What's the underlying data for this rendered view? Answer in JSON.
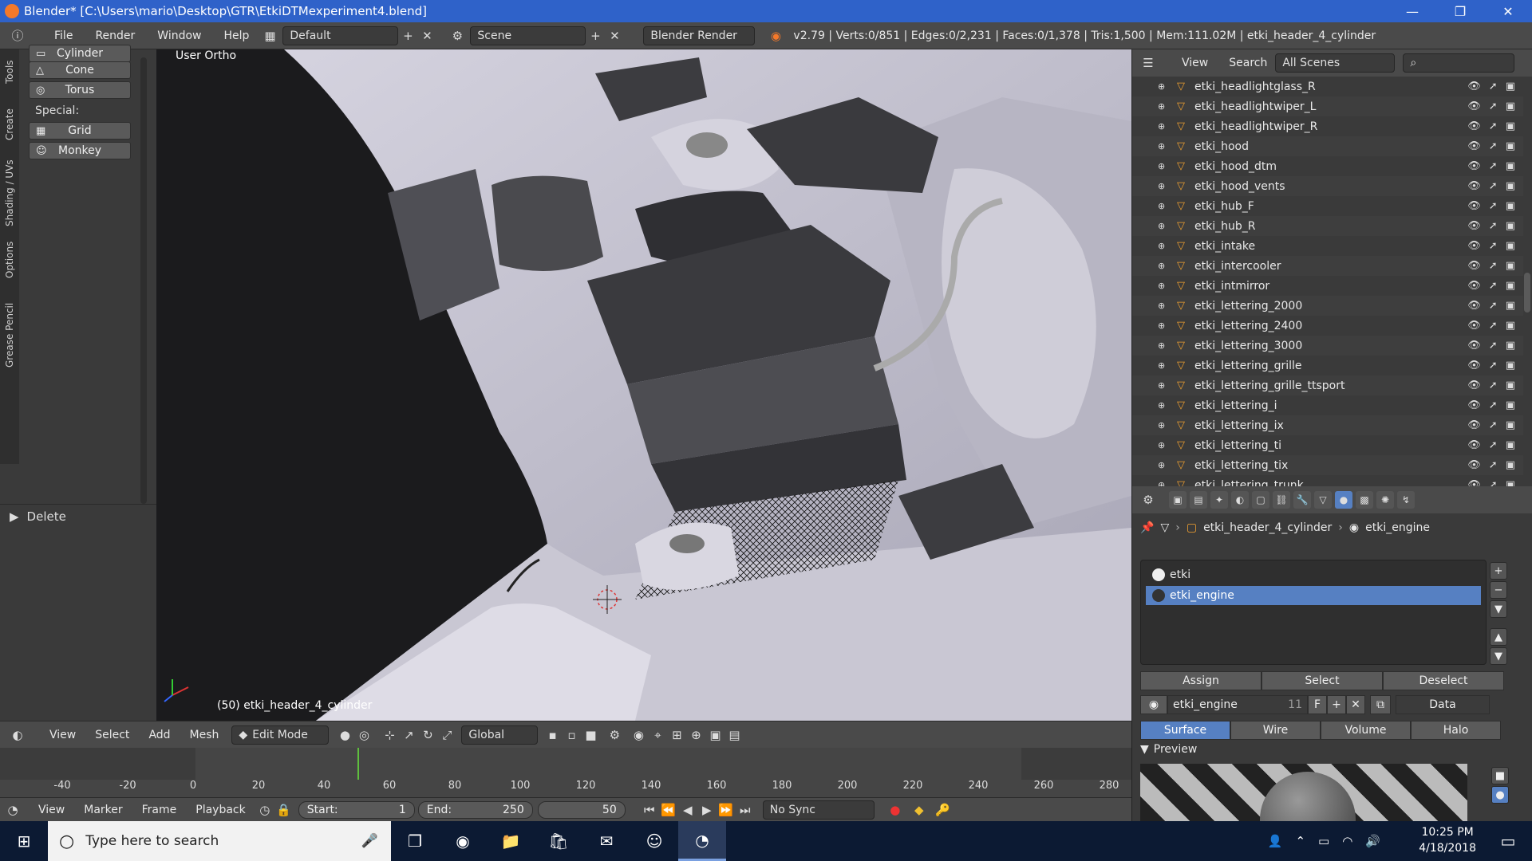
{
  "window": {
    "title": "Blender* [C:\\Users\\mario\\Desktop\\GTR\\EtkiDTMexperiment4.blend]",
    "min": "—",
    "max": "❐",
    "close": "✕"
  },
  "info": {
    "menus": [
      "File",
      "Render",
      "Window",
      "Help"
    ],
    "layout": "Default",
    "scene": "Scene",
    "engine": "Blender Render",
    "stats": "v2.79 | Verts:0/851 | Edges:0/2,231 | Faces:0/1,378 | Tris:1,500 | Mem:111.02M | etki_header_4_cylinder"
  },
  "toolshelf": {
    "tabs": [
      "Tools",
      "Create",
      "Shading / UVs",
      "Options",
      "Grease Pencil"
    ],
    "buttons": [
      "Cylinder",
      "Cone",
      "Torus"
    ],
    "special_label": "Special:",
    "special": [
      "Grid",
      "Monkey"
    ],
    "redo_label": "Delete"
  },
  "viewport": {
    "view_label": "User Ortho",
    "object_label": "(50) etki_header_4_cylinder"
  },
  "v3d_header": {
    "menus": [
      "View",
      "Select",
      "Add",
      "Mesh"
    ],
    "mode": "Edit Mode",
    "orientation": "Global"
  },
  "timeline": {
    "ticks": [
      "-40",
      "-20",
      "0",
      "20",
      "40",
      "60",
      "80",
      "100",
      "120",
      "140",
      "160",
      "180",
      "200",
      "220",
      "240",
      "260",
      "280"
    ],
    "menus": [
      "View",
      "Marker",
      "Frame",
      "Playback"
    ],
    "start_label": "Start:",
    "start": "1",
    "end_label": "End:",
    "end": "250",
    "current": "50",
    "sync": "No Sync",
    "current_frame_fraction": 0.5
  },
  "outliner": {
    "menus": [
      "View",
      "Search"
    ],
    "filter": "All Scenes",
    "items": [
      "etki_headlightglass_R",
      "etki_headlightwiper_L",
      "etki_headlightwiper_R",
      "etki_hood",
      "etki_hood_dtm",
      "etki_hood_vents",
      "etki_hub_F",
      "etki_hub_R",
      "etki_intake",
      "etki_intercooler",
      "etki_intmirror",
      "etki_lettering_2000",
      "etki_lettering_2400",
      "etki_lettering_3000",
      "etki_lettering_grille",
      "etki_lettering_grille_ttsport",
      "etki_lettering_i",
      "etki_lettering_ix",
      "etki_lettering_ti",
      "etki_lettering_tix",
      "etki_lettering_trunk"
    ]
  },
  "properties": {
    "object": "etki_header_4_cylinder",
    "material": "etki_engine",
    "slots": [
      "etki",
      "etki_engine"
    ],
    "assign": "Assign",
    "select": "Select",
    "deselect": "Deselect",
    "mat_name": "etki_engine",
    "users": "11",
    "fake": "F",
    "link": "Data",
    "tabs": [
      "Surface",
      "Wire",
      "Volume",
      "Halo"
    ],
    "preview": "Preview"
  },
  "taskbar": {
    "search": "Type here to search",
    "time": "10:25 PM",
    "date": "4/18/2018"
  },
  "colors": {
    "accent": "#5680c2",
    "title_bar": "#2f62c9",
    "object_icon": "#f0a030"
  }
}
